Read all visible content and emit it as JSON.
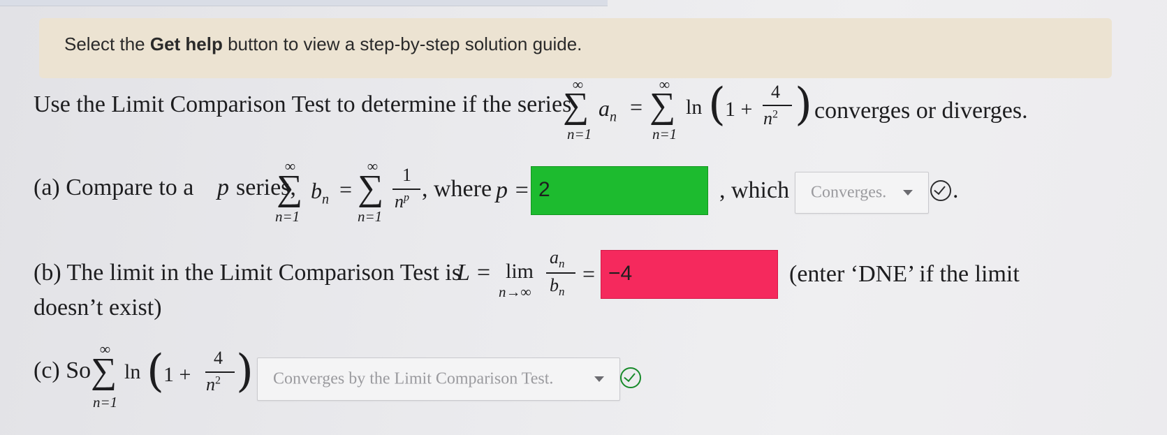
{
  "banner": {
    "prefix": "Select the ",
    "bold": "Get help",
    "suffix": " button to view a step-by-step solution guide."
  },
  "question": {
    "intro": "Use the Limit Comparison Test to determine if the series",
    "tail": "converges or diverges.",
    "a_n": "a",
    "n_sub": "n",
    "ln": "ln",
    "one_plus": "1 +",
    "num4": "4",
    "n2": "n",
    "sup2": "2",
    "eq": "=",
    "inf": "∞",
    "lower": "n=1",
    "sigma": "∑"
  },
  "part_a": {
    "label": "(a) Compare to a",
    "p": "p",
    "series_word": "series,",
    "b_n": "b",
    "one": "1",
    "np_n": "n",
    "np_p": "p",
    "where": ", where",
    "p_eq": "p =",
    "answer": "2",
    "which": ", which",
    "select_value": "Converges.",
    "period": "."
  },
  "part_b": {
    "label": "(b) The limit in the Limit Comparison Test is",
    "L_eq": "L =",
    "lim": "lim",
    "lim_sub": "n→∞",
    "answer": "−4",
    "note": "(enter ‘DNE’ if the limit",
    "note2": "doesn’t exist)"
  },
  "part_c": {
    "label": "(c) So",
    "select_value": "Converges by the Limit Comparison Test."
  },
  "colors": {
    "correct": "#1dbb2f",
    "incorrect": "#f5295d",
    "banner_bg": "#ece3d2"
  },
  "icons": [
    "dropdown-caret-icon",
    "check-circle-icon"
  ]
}
